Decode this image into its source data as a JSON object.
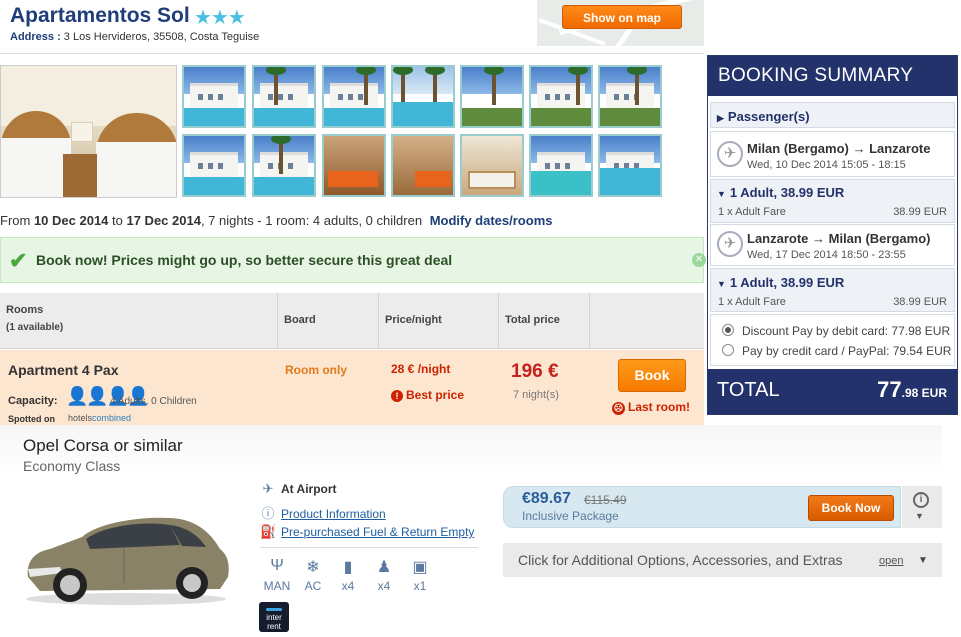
{
  "hotel": {
    "name": "Apartamentos Sol",
    "stars": "★★★",
    "address_label": "Address :",
    "address": " 3 Los Hervideros, 35508, Costa Teguise",
    "show_on_map": "Show on map"
  },
  "dates": {
    "prefix": "From ",
    "from": "10 Dec 2014",
    "to_word": " to ",
    "to": "17 Dec 2014",
    "rest": ", 7 nights - 1 room: 4 adults, 0 children",
    "modify": "Modify dates/rooms"
  },
  "alert": {
    "text": "Book now! Prices might go up, so better secure this great deal",
    "close": "✕"
  },
  "rooms_table": {
    "headers": {
      "rooms": "Rooms",
      "rooms_available": "(1 available)",
      "board": "Board",
      "price_night": "Price/night",
      "total_price": "Total price"
    },
    "row": {
      "name": "Apartment 4 Pax",
      "capacity_label": "Capacity:",
      "people_icons": "👤👤👤👤",
      "capacity_text": "4 Adults, 0 Children",
      "spotted_on": "Spotted on",
      "hc_logo_hotels": "hotels",
      "hc_logo_combined": "combined",
      "board": "Room only",
      "price_night": "28 € /night",
      "best_price": "Best price",
      "total": "196 €",
      "nights": "7 night(s)",
      "book": "Book",
      "last_room": "Last room!"
    }
  },
  "booking_summary": {
    "title": "BOOKING SUMMARY",
    "passengers": "Passenger(s)",
    "outbound": {
      "route": "Milan (Bergamo) → Lanzarote",
      "date": "Wed, 10 Dec 2014 15:05 - 18:15",
      "adult": "1 Adult, 38.99 EUR",
      "fare_label": "1 x Adult Fare",
      "fare_value": "38.99 EUR"
    },
    "inbound": {
      "route": "Lanzarote → Milan (Bergamo)",
      "date": "Wed, 17 Dec 2014 18:50 - 23:55",
      "adult": "1 Adult, 38.99 EUR",
      "fare_label": "1 x Adult Fare",
      "fare_value": "38.99 EUR"
    },
    "payment": [
      {
        "text": "Discount Pay by debit card: 77.98 EUR",
        "selected": true
      },
      {
        "text": "Pay by credit card / PayPal: 79.54 EUR",
        "selected": false
      }
    ],
    "total_label": "TOTAL",
    "total_main": "77",
    "total_dec": ".98 EUR"
  },
  "car": {
    "name": "Opel Corsa or similar",
    "class": "Economy Class",
    "at_airport": "At Airport",
    "product_info": "Product Information",
    "fuel": "Pre-purchased Fuel & Return Empty",
    "specs": [
      {
        "icon": "Ψ",
        "label": "MAN"
      },
      {
        "icon": "❄",
        "label": "AC"
      },
      {
        "icon": "▮",
        "label": "x4"
      },
      {
        "icon": "♟",
        "label": "x4"
      },
      {
        "icon": "▣",
        "label": "x1"
      }
    ],
    "supplier": "inter rent",
    "price": "€89.67",
    "old_price": "€115.49",
    "package": "Inclusive Package",
    "book_now": "Book Now",
    "options": "Click for Additional Options, Accessories, and Extras",
    "open": "open"
  },
  "colors": {
    "brand_navy": "#23326a",
    "accent_orange": "#f57b00",
    "alert_green": "#49a83b",
    "price_red": "#c4221c"
  }
}
